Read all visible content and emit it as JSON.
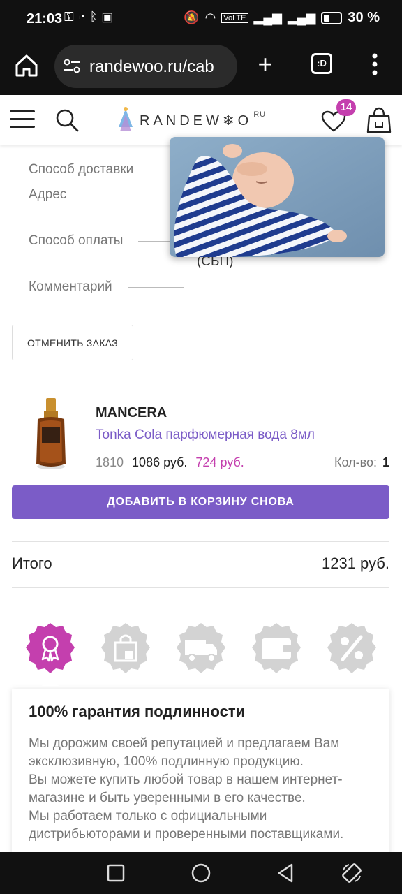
{
  "status": {
    "time": "21:03",
    "battery": "30 %"
  },
  "browser": {
    "url": "randewoo.ru/cab",
    "tabs_label": ":D"
  },
  "header": {
    "logo_text": "RANDEW❄O",
    "logo_suffix": "RU",
    "favorites_count": "14"
  },
  "order": {
    "fields": [
      {
        "label": "Способ доставки"
      },
      {
        "label": "Адрес"
      },
      {
        "label": "Способ оплаты"
      },
      {
        "label": "Комментарий"
      }
    ],
    "partial_value": "(СБП)",
    "cancel_label": "ОТМЕНИТЬ ЗАКАЗ"
  },
  "product": {
    "brand": "MANCERA",
    "name": "Tonka Cola парфюмерная вода 8мл",
    "price_old": "1810",
    "price_current": "1086 руб.",
    "price_discount": "724 руб.",
    "qty_label": "Кол-во:",
    "qty_value": "1",
    "add_label": "ДОБАВИТЬ В КОРЗИНУ СНОВА"
  },
  "total": {
    "label": "Итого",
    "value": "1231 руб."
  },
  "features": {
    "icons": [
      "award-icon",
      "shopping-bag-icon",
      "truck-icon",
      "wallet-icon",
      "percent-icon"
    ],
    "active_color": "#c43fae",
    "inactive_color": "#d3d3d3",
    "title": "100% гарантия подлинности",
    "text": [
      "Мы дорожим своей репутацией и предлагаем Вам эксклюзивную, 100% подлинную продукцию.",
      "Вы можете купить любой товар в нашем интернет-магазине и быть уверенными в его качестве.",
      "Мы работаем только с официальными дистрибьюторами и проверенными поставщиками."
    ]
  },
  "colors": {
    "accent": "#7b5cc7",
    "pink": "#c43fae"
  }
}
